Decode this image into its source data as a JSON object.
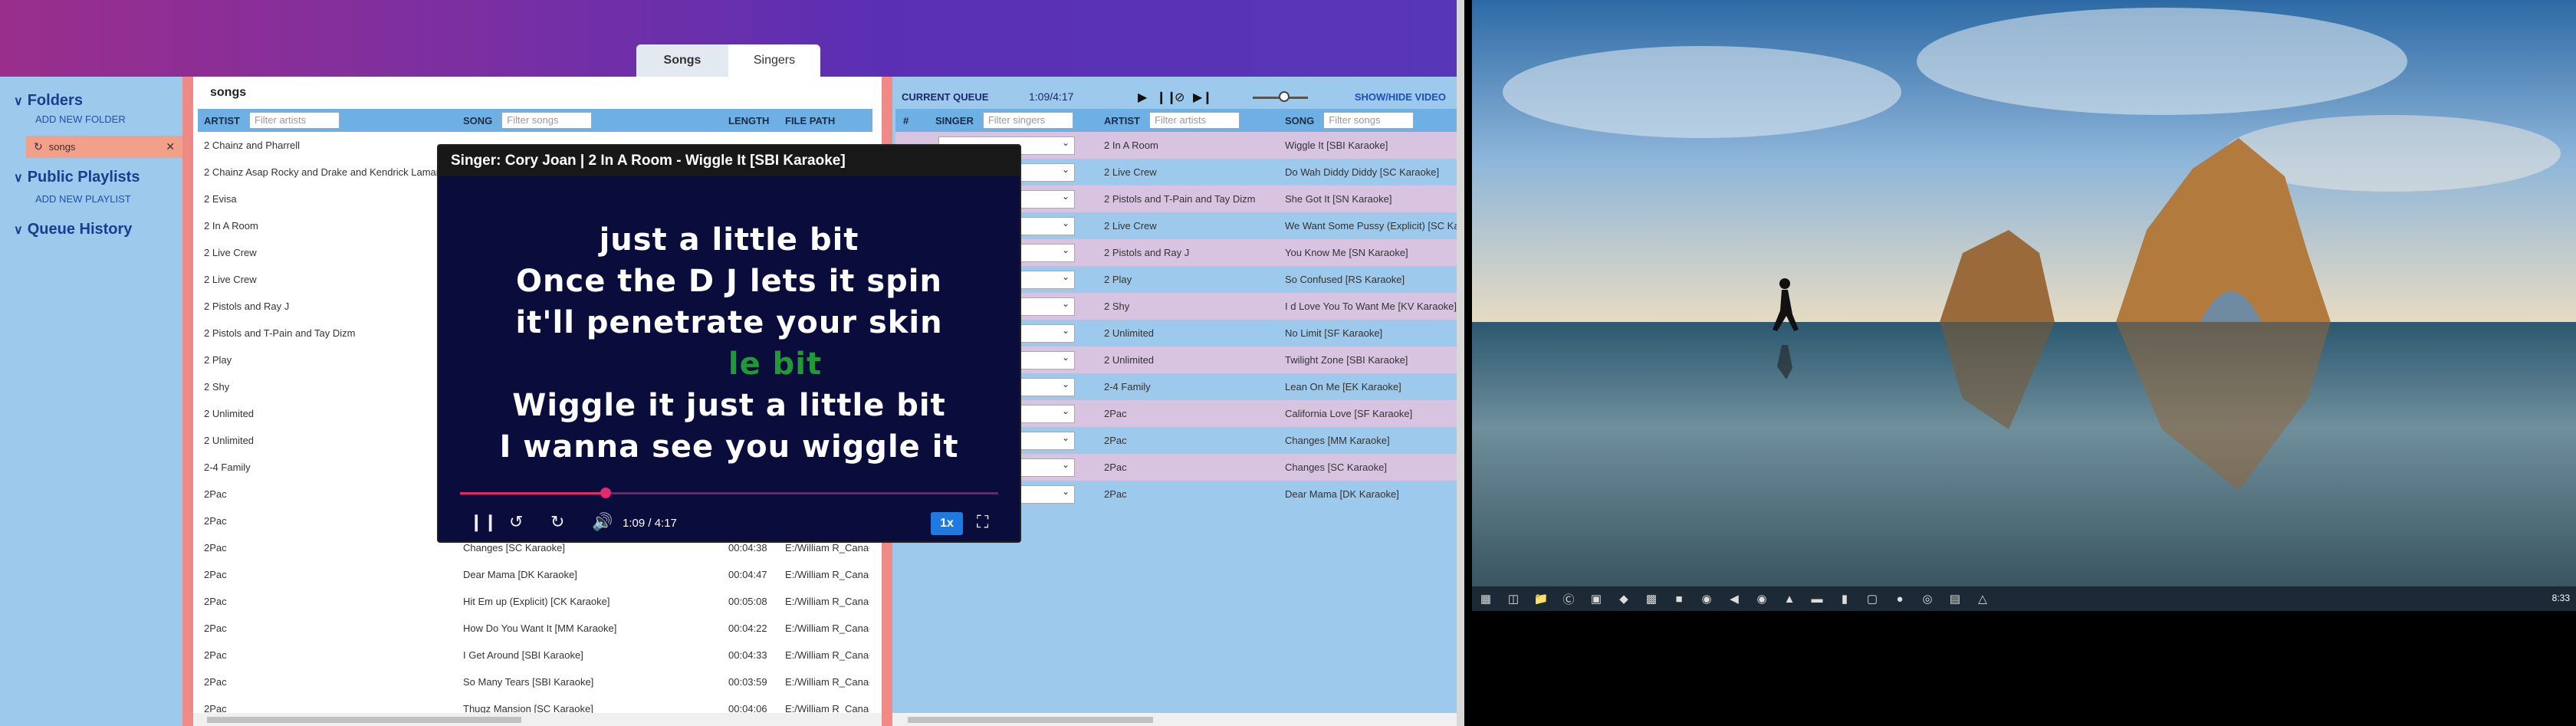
{
  "tabs": [
    {
      "label": "Songs",
      "active": true
    },
    {
      "label": "Singers",
      "active": false
    }
  ],
  "sidebar": {
    "folders": {
      "title": "Folders",
      "add": "ADD NEW FOLDER",
      "items": [
        {
          "label": "songs"
        }
      ]
    },
    "playlists": {
      "title": "Public Playlists",
      "add": "ADD NEW PLAYLIST"
    },
    "history": {
      "title": "Queue History"
    }
  },
  "songs": {
    "search_value": "songs",
    "headers": {
      "artist": "ARTIST",
      "artist_ph": "Filter artists",
      "song": "SONG",
      "song_ph": "Filter songs",
      "length": "LENGTH",
      "path": "FILE PATH"
    },
    "rows": [
      {
        "artist": "2 Chainz and Pharrell",
        "song": "",
        "length": "",
        "path": ""
      },
      {
        "artist": "2 Chainz Asap Rocky and Drake and Kendrick Lamar",
        "song": "",
        "length": "",
        "path": ""
      },
      {
        "artist": "2 Evisa",
        "song": "",
        "length": "",
        "path": ""
      },
      {
        "artist": "2 In A Room",
        "song": "",
        "length": "",
        "path": ""
      },
      {
        "artist": "2 Live Crew",
        "song": "",
        "length": "",
        "path": ""
      },
      {
        "artist": "2 Live Crew",
        "song": "",
        "length": "",
        "path": ""
      },
      {
        "artist": "2 Pistols and Ray J",
        "song": "",
        "length": "",
        "path": ""
      },
      {
        "artist": "2 Pistols and T-Pain and Tay Dizm",
        "song": "",
        "length": "",
        "path": ""
      },
      {
        "artist": "2 Play",
        "song": "",
        "length": "",
        "path": ""
      },
      {
        "artist": "2 Shy",
        "song": "",
        "length": "",
        "path": ""
      },
      {
        "artist": "2 Unlimited",
        "song": "",
        "length": "",
        "path": ""
      },
      {
        "artist": "2 Unlimited",
        "song": "",
        "length": "",
        "path": ""
      },
      {
        "artist": "2-4 Family",
        "song": "",
        "length": "",
        "path": ""
      },
      {
        "artist": "2Pac",
        "song": "",
        "length": "",
        "path": ""
      },
      {
        "artist": "2Pac",
        "song": "",
        "length": "",
        "path": ""
      },
      {
        "artist": "2Pac",
        "song": "Changes [SC Karaoke]",
        "length": "00:04:38",
        "path": "E:/William R_Canac"
      },
      {
        "artist": "2Pac",
        "song": "Dear Mama [DK Karaoke]",
        "length": "00:04:47",
        "path": "E:/William R_Canac"
      },
      {
        "artist": "2Pac",
        "song": "Hit Em up (Explicit) [CK Karaoke]",
        "length": "00:05:08",
        "path": "E:/William R_Canac"
      },
      {
        "artist": "2Pac",
        "song": "How Do You Want It [MM Karaoke]",
        "length": "00:04:22",
        "path": "E:/William R_Canac"
      },
      {
        "artist": "2Pac",
        "song": "I Get Around [SBI Karaoke]",
        "length": "00:04:33",
        "path": "E:/William R_Canac"
      },
      {
        "artist": "2Pac",
        "song": "So Many Tears [SBI Karaoke]",
        "length": "00:03:59",
        "path": "E:/William R_Canac"
      },
      {
        "artist": "2Pac",
        "song": "Thugz Mansion [SC Karaoke]",
        "length": "00:04:06",
        "path": "E:/William R_Canac"
      }
    ]
  },
  "queue": {
    "title": "CURRENT QUEUE",
    "time": "1:09/4:17",
    "volume": 0.5,
    "show_hide": "SHOW/HIDE VIDEO",
    "headers": {
      "num": "#",
      "singer": "SINGER",
      "singer_ph": "Filter singers",
      "artist": "ARTIST",
      "artist_ph": "Filter artists",
      "song": "SONG",
      "song_ph": "Filter songs"
    },
    "rows": [
      {
        "artist": "2 In A Room",
        "song": "Wiggle It [SBI Karaoke]"
      },
      {
        "artist": "2 Live Crew",
        "song": "Do Wah Diddy Diddy [SC Karaoke]"
      },
      {
        "artist": "2 Pistols and T-Pain and Tay Dizm",
        "song": "She Got It [SN Karaoke]"
      },
      {
        "artist": "2 Live Crew",
        "song": "We Want Some Pussy (Explicit) [SC Karaoke]"
      },
      {
        "artist": "2 Pistols and Ray J",
        "song": "You Know Me [SN Karaoke]"
      },
      {
        "artist": "2 Play",
        "song": "So Confused [RS Karaoke]"
      },
      {
        "artist": "2 Shy",
        "song": "I d Love You To Want Me [KV Karaoke]"
      },
      {
        "artist": "2 Unlimited",
        "song": "No Limit [SF Karaoke]"
      },
      {
        "artist": "2 Unlimited",
        "song": "Twilight Zone [SBI Karaoke]"
      },
      {
        "artist": "2-4 Family",
        "song": "Lean On Me [EK Karaoke]"
      },
      {
        "artist": "2Pac",
        "song": "California Love [SF Karaoke]"
      },
      {
        "artist": "2Pac",
        "song": "Changes [MM Karaoke]"
      },
      {
        "artist": "2Pac",
        "song": "Changes [SC Karaoke]"
      },
      {
        "artist": "2Pac",
        "song": "Dear Mama [DK Karaoke]"
      }
    ]
  },
  "video": {
    "title": "Singer: Cory Joan | 2 In A Room - Wiggle It [SBI Karaoke]",
    "lyrics": [
      "just a little bit",
      "Once the D J lets it spin",
      "it'll penetrate your skin",
      "le bit",
      "Wiggle it just a little bit",
      "I wanna see you wiggle it"
    ],
    "time": "1:09 / 4:17",
    "progress": 0.27,
    "rate": "1x"
  },
  "desktop": {
    "clock": "8:33"
  }
}
